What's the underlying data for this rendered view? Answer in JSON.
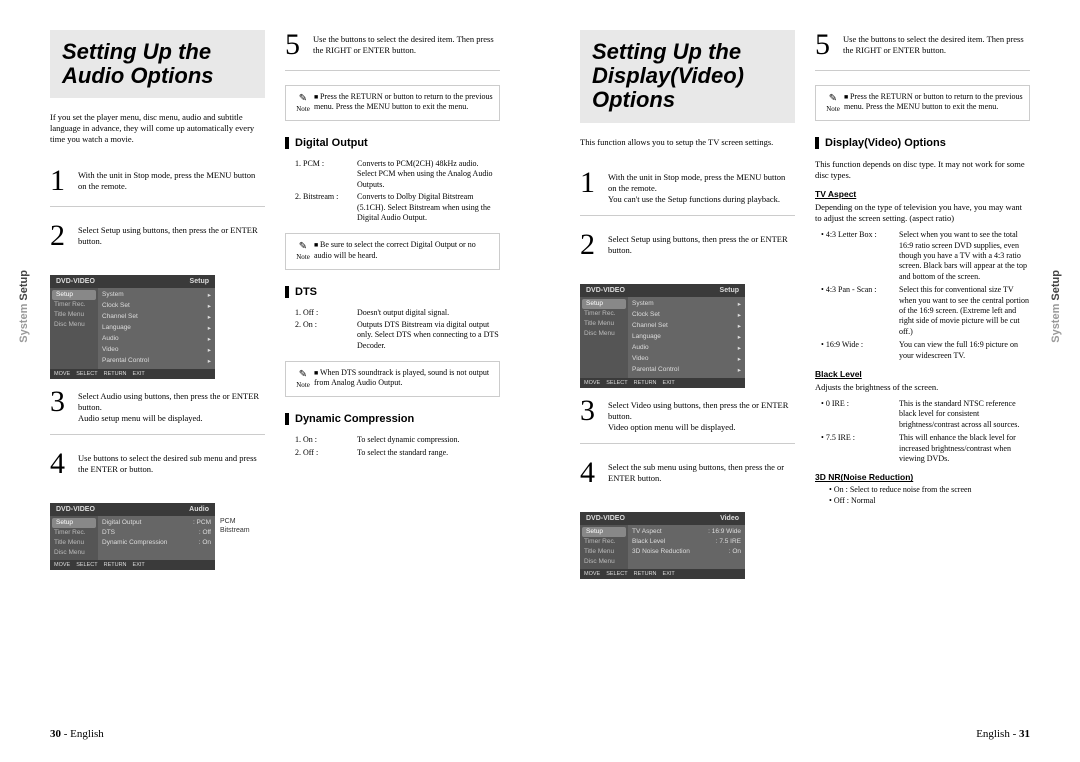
{
  "side_tab": "System Setup",
  "footer": {
    "left_num": "30",
    "right_num": "31",
    "lang": "English"
  },
  "left": {
    "title": "Setting Up the Audio Options",
    "intro": "If you set the player menu, disc menu, audio and subtitle language in advance, they will come up automatically every time you watch a movie.",
    "steps": [
      "With the unit in Stop mode, press the MENU button on the remote.",
      "Select Setup using          buttons, then press the     or ENTER button.",
      "Select Audio using          buttons, then press the     or ENTER button.\nAudio setup menu will be displayed.",
      "Use        buttons to select the desired sub menu and press the ENTER or        button."
    ],
    "r_step5": "Use the          buttons to select the desired item. Then press the RIGHT or ENTER button.",
    "r_note1": "Press the RETURN or        button to return to the previous menu. Press the MENU button to exit the menu.",
    "digital_h": "Digital Output",
    "digital": [
      {
        "k": "1. PCM  :",
        "d": "Converts to PCM(2CH) 48kHz audio. Select PCM when using the Analog Audio Outputs."
      },
      {
        "k": "2. Bitstream :",
        "d": "Converts to Dolby Digital Bitstream (5.1CH). Select Bitstream when using the Digital Audio Output."
      }
    ],
    "r_note2": "Be sure to select the correct Digital Output or no audio will be heard.",
    "dts_h": "DTS",
    "dts": [
      {
        "k": "1. Off  :",
        "d": "Doesn't output digital signal."
      },
      {
        "k": "2. On  :",
        "d": "Outputs DTS Bitstream via digital output only. Select DTS when connecting to a DTS Decoder."
      }
    ],
    "r_note3": "When DTS soundtrack is played, sound is not output from Analog Audio Output.",
    "dyn_h": "Dynamic Compression",
    "dyn": [
      {
        "k": "1. On  :",
        "d": "To select dynamic compression."
      },
      {
        "k": "2. Off  :",
        "d": "To select the standard range."
      }
    ],
    "osd1": {
      "title_l": "DVD-VIDEO",
      "title_r": "Setup",
      "side": [
        "Setup",
        "Timer Rec.",
        "Title Menu",
        "Disc Menu"
      ],
      "main": [
        "System",
        "Clock Set",
        "Channel Set",
        "Language",
        "Audio",
        "Video",
        "Parental Control"
      ],
      "foot": [
        "MOVE",
        "SELECT",
        "RETURN",
        "EXIT"
      ]
    },
    "osd2": {
      "title_l": "DVD-VIDEO",
      "title_r": "Audio",
      "side": [
        "Setup",
        "Timer Rec.",
        "Title Menu",
        "Disc Menu"
      ],
      "main": [
        {
          "l": "Digital Output",
          "r": ": PCM"
        },
        {
          "l": "DTS",
          "r": ": Off"
        },
        {
          "l": "Dynamic Compression",
          "r": ": On"
        }
      ],
      "foot": [
        "MOVE",
        "SELECT",
        "RETURN",
        "EXIT"
      ],
      "label": "PCM\nBitstream"
    }
  },
  "right": {
    "title": "Setting Up the Display(Video) Options",
    "intro": "This function allows you to setup the TV screen settings.",
    "steps": [
      "With the unit in Stop mode, press the MENU button on the remote.\nYou can't use the Setup functions during playback.",
      "Select Setup using          buttons, then press the     or ENTER button.",
      "Select Video using          buttons, then press the     or ENTER button.\nVideo option menu will be displayed.",
      "Select the sub menu using             buttons, then press the     or ENTER button."
    ],
    "r_step5": "Use the          buttons to select the desired item. Then press the RIGHT or ENTER button.",
    "r_note1": "Press the RETURN or        button to return to the previous menu. Press the MENU button to exit the menu.",
    "disp_h": "Display(Video) Options",
    "disp_intro": "This function depends on disc type. It may not work for some disc types.",
    "tva_h": "TV Aspect",
    "tva_intro": "Depending on the type of television you have, you may want to adjust the screen setting. (aspect ratio)",
    "tva": [
      {
        "k": "4:3 Letter  Box :",
        "d": "Select when you want to see the total 16:9 ratio screen DVD supplies, even though you have a TV with a 4:3 ratio screen. Black bars will appear at the top and bottom of the screen."
      },
      {
        "k": "4:3 Pan - Scan :",
        "d": "Select this for conventional size TV when you want to see the central portion of the 16:9 screen. (Extreme left and right side of movie picture will be cut off.)"
      },
      {
        "k": "16:9 Wide :",
        "d": "You can view the full 16:9 picture on your widescreen TV."
      }
    ],
    "bl_h": "Black Level",
    "bl_intro": "Adjusts the brightness of the screen.",
    "bl": [
      {
        "k": "0 IRE :",
        "d": "This is the standard NTSC reference black level for consistent brightness/contrast across all sources."
      },
      {
        "k": "7.5 IRE :",
        "d": "This will  enhance the black level for increased brightness/contrast when viewing DVDs."
      }
    ],
    "nr_h": "3D NR(Noise Reduction)",
    "nr": [
      "On : Select to reduce noise from the screen",
      "Off : Normal"
    ],
    "osd1": {
      "title_l": "DVD-VIDEO",
      "title_r": "Setup",
      "side": [
        "Setup",
        "Timer Rec.",
        "Title Menu",
        "Disc Menu"
      ],
      "main": [
        "System",
        "Clock Set",
        "Channel Set",
        "Language",
        "Audio",
        "Video",
        "Parental Control"
      ],
      "foot": [
        "MOVE",
        "SELECT",
        "RETURN",
        "EXIT"
      ]
    },
    "osd2": {
      "title_l": "DVD-VIDEO",
      "title_r": "Video",
      "side": [
        "Setup",
        "Timer Rec.",
        "Title Menu",
        "Disc Menu"
      ],
      "main": [
        {
          "l": "TV Aspect",
          "r": ": 16:9 Wide"
        },
        {
          "l": "Black Level",
          "r": ": 7.5 IRE"
        },
        {
          "l": "3D Noise Reduction",
          "r": ": On"
        }
      ],
      "foot": [
        "MOVE",
        "SELECT",
        "RETURN",
        "EXIT"
      ]
    }
  }
}
